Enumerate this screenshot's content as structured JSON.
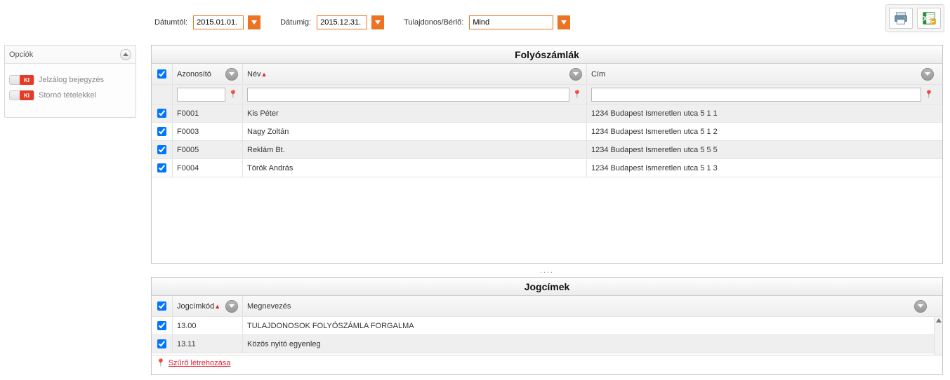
{
  "filters": {
    "date_from_label": "Dátumtól:",
    "date_from_value": "2015.01.01.",
    "date_to_label": "Dátumig:",
    "date_to_value": "2015.12.31.",
    "owner_label": "Tulajdonos/Bérlő:",
    "owner_value": "Mind"
  },
  "options": {
    "title": "Opciók",
    "items": [
      {
        "label": "Jelzálog bejegyzés",
        "state": "KI"
      },
      {
        "label": "Stornó tételekkel",
        "state": "KI"
      }
    ]
  },
  "accounts": {
    "title": "Folyószámlák",
    "columns": {
      "id": "Azonosító",
      "name": "Név",
      "address": "Cím"
    },
    "rows": [
      {
        "id": "F0001",
        "name": "Kis Péter",
        "address": "1234 Budapest Ismeretlen utca 5 1 1"
      },
      {
        "id": "F0003",
        "name": "Nagy Zoltán",
        "address": "1234 Budapest Ismeretlen utca 5 1 2"
      },
      {
        "id": "F0005",
        "name": "Reklám Bt.",
        "address": "1234 Budapest Ismeretlen utca 5 5 5"
      },
      {
        "id": "F0004",
        "name": "Török András",
        "address": "1234 Budapest Ismeretlen utca 5 1 3"
      }
    ]
  },
  "titles": {
    "title": "Jogcímek",
    "columns": {
      "code": "Jogcímkód",
      "name": "Megnevezés"
    },
    "rows": [
      {
        "code": "13.00",
        "name": "TULAJDONOSOK FOLYÓSZÁMLA FORGALMA"
      },
      {
        "code": "13.11",
        "name": "Közös nyitó egyenleg"
      }
    ],
    "filter_link": "Szűrő létrehozása"
  },
  "splitter": "...."
}
